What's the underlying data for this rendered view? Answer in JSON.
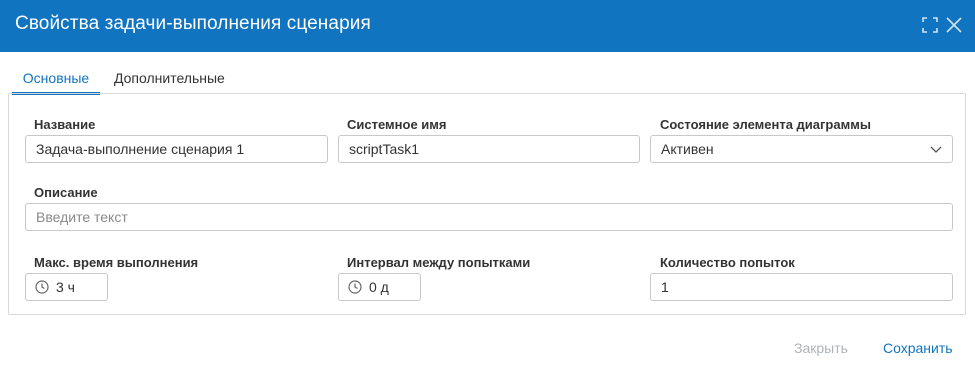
{
  "dialog": {
    "title": "Свойства задачи-выполнения сценария"
  },
  "tabs": [
    {
      "label": "Основные",
      "active": true
    },
    {
      "label": "Дополнительные",
      "active": false
    }
  ],
  "form": {
    "name": {
      "label": "Название",
      "value": "Задача-выполнение сценария 1"
    },
    "system_name": {
      "label": "Системное имя",
      "value": "scriptTask1"
    },
    "state": {
      "label": "Состояние элемента диаграммы",
      "value": "Активен"
    },
    "description": {
      "label": "Описание",
      "value": "",
      "placeholder": "Введите текст"
    },
    "max_time": {
      "label": "Макс. время выполнения",
      "value": "3 ч"
    },
    "retry_interval": {
      "label": "Интервал между попытками",
      "value": "0 д"
    },
    "retry_count": {
      "label": "Количество попыток",
      "value": "1"
    }
  },
  "footer": {
    "close_label": "Закрыть",
    "save_label": "Сохранить"
  },
  "icons": {
    "expand": "expand-icon",
    "close": "close-icon",
    "clock": "clock-icon",
    "chevron": "chevron-down-icon"
  },
  "colors": {
    "accent": "#1174c1",
    "disabled_text": "#aeb4ba",
    "border": "#c8c8c8"
  }
}
